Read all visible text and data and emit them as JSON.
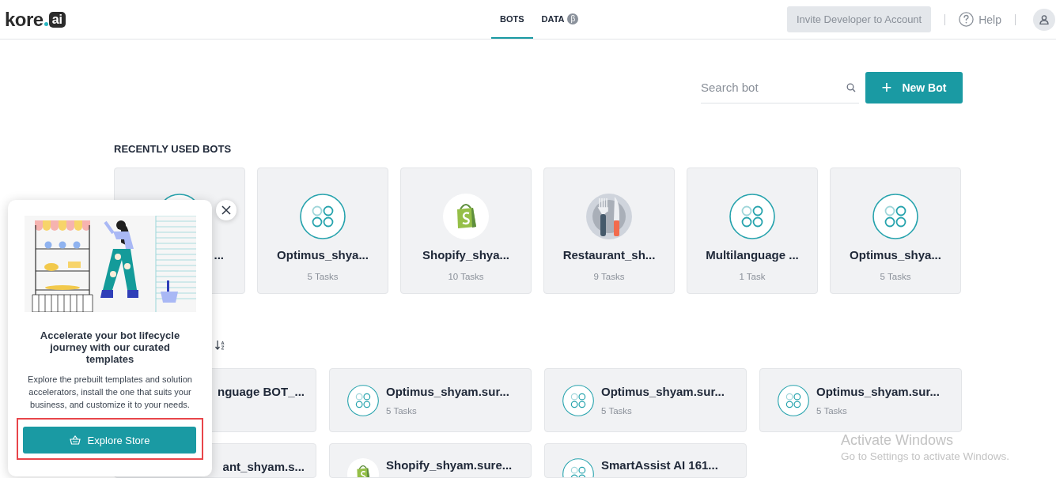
{
  "header": {
    "logo": {
      "text": "kore",
      "badge": "ai"
    },
    "tabs": [
      {
        "label": "BOTS",
        "selected": true
      },
      {
        "label": "DATA",
        "badge": "β",
        "selected": false
      }
    ],
    "invite_button": {
      "label": "Invite Developer to Account",
      "disabled": true
    },
    "help": {
      "label": "Help"
    }
  },
  "toolbar": {
    "search": {
      "placeholder": "Search bot"
    },
    "new_bot_button": {
      "icon": "+",
      "label": "New Bot"
    }
  },
  "recent": {
    "title": "RECENTLY USED BOTS",
    "bots": [
      {
        "name": "...",
        "kind": "grid",
        "partial": true
      },
      {
        "name": "Optimus_shya...",
        "tasks": "5 Tasks",
        "kind": "grid",
        "partial": false
      },
      {
        "name": "Shopify_shya...",
        "tasks": "10 Tasks",
        "kind": "shopify",
        "partial": false
      },
      {
        "name": "Restaurant_sh...",
        "tasks": "9 Tasks",
        "kind": "restaurant",
        "partial": false
      },
      {
        "name": "Multilanguage ...",
        "tasks": "1 Task",
        "kind": "grid",
        "partial": false
      },
      {
        "name": "Optimus_shya...",
        "tasks": "5 Tasks",
        "kind": "grid",
        "partial": false
      }
    ]
  },
  "all_bots": {
    "bots": [
      {
        "name": "nguage BOT_...",
        "partial": true
      },
      {
        "name": "Optimus_shyam.sur...",
        "tasks": "5 Tasks",
        "kind": "grid",
        "partial": false
      },
      {
        "name": "Optimus_shyam.sur...",
        "tasks": "5 Tasks",
        "kind": "grid",
        "partial": false
      },
      {
        "name": "Optimus_shyam.sur...",
        "tasks": "5 Tasks",
        "kind": "grid",
        "partial": false
      },
      {
        "name": "ant_shyam.s...",
        "partial": true
      },
      {
        "name": "Shopify_shyam.sure...",
        "kind": "shopify",
        "partial": false
      },
      {
        "name": "SmartAssist AI 161...",
        "kind": "grid",
        "partial": false
      }
    ]
  },
  "store_popup": {
    "title": "Accelerate your bot lifecycle journey with our curated templates",
    "text": "Explore the prebuilt templates and solution accelerators, install the one that suits your business, and customize it to your needs.",
    "button": {
      "label": "Explore Store",
      "highlighted": true
    }
  },
  "os_notice": {
    "title": "Activate Windows",
    "text": "Go to Settings to activate Windows."
  }
}
